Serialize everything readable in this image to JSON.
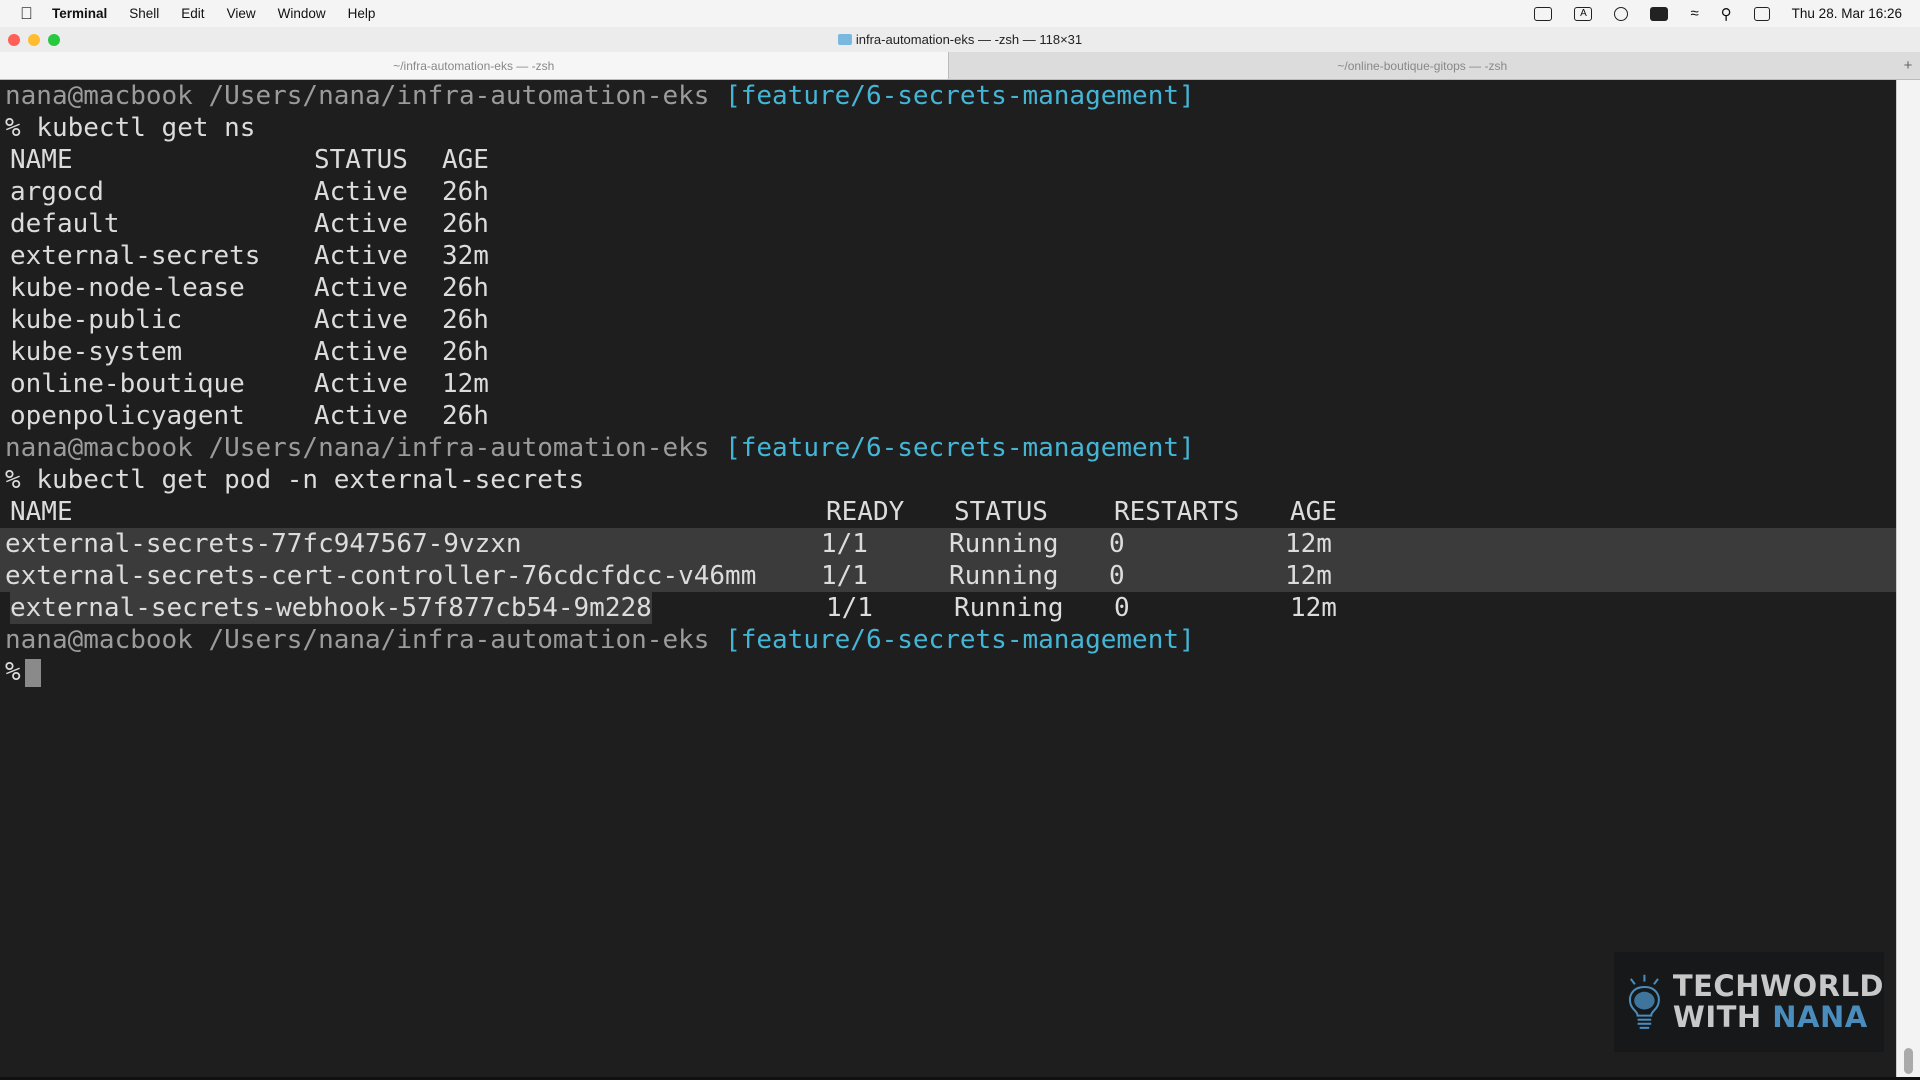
{
  "menubar": {
    "app": "Terminal",
    "items": [
      "Shell",
      "Edit",
      "View",
      "Window",
      "Help"
    ],
    "status_icons": [
      "screen-record-icon",
      "input-source-icon",
      "play-icon",
      "battery-icon",
      "wifi-icon",
      "search-icon",
      "control-center-icon"
    ],
    "input_source": "A",
    "clock": "Thu 28. Mar  16:26"
  },
  "window": {
    "title": "infra-automation-eks — -zsh — 118×31",
    "tabs": [
      {
        "label": "~/infra-automation-eks — -zsh",
        "active": true
      },
      {
        "label": "~/online-boutique-gitops — -zsh",
        "active": false
      }
    ],
    "new_tab": "+"
  },
  "prompt": {
    "user": "nana@macbook",
    "path": "/Users/nana/infra-automation-eks",
    "branch": "[feature/6-secrets-management]",
    "symbol": "%"
  },
  "commands": [
    "kubectl get ns",
    "kubectl get pod -n external-secrets"
  ],
  "ns_table": {
    "headers": [
      "NAME",
      "STATUS",
      "AGE"
    ],
    "rows": [
      [
        "argocd",
        "Active",
        "26h"
      ],
      [
        "default",
        "Active",
        "26h"
      ],
      [
        "external-secrets",
        "Active",
        "32m"
      ],
      [
        "kube-node-lease",
        "Active",
        "26h"
      ],
      [
        "kube-public",
        "Active",
        "26h"
      ],
      [
        "kube-system",
        "Active",
        "26h"
      ],
      [
        "online-boutique",
        "Active",
        "12m"
      ],
      [
        "openpolicyagent",
        "Active",
        "26h"
      ]
    ]
  },
  "pod_table": {
    "headers": [
      "NAME",
      "READY",
      "STATUS",
      "RESTARTS",
      "AGE"
    ],
    "rows": [
      [
        "external-secrets-77fc947567-9vzxn",
        "1/1",
        "Running",
        "0",
        "12m"
      ],
      [
        "external-secrets-cert-controller-76cdcfdcc-v46mm",
        "1/1",
        "Running",
        "0",
        "12m"
      ],
      [
        "external-secrets-webhook-57f877cb54-9m228",
        "1/1",
        "Running",
        "0",
        "12m"
      ]
    ]
  },
  "logo": {
    "line1": "TECHWORLD",
    "line2a": "WITH",
    "line2b": "NANA"
  },
  "colors": {
    "background": "#1e1e1e",
    "text": "#dcdcdc",
    "prompt": "#9b9b9b",
    "branch": "#45b5d6",
    "selection": "#3b3b3b"
  }
}
